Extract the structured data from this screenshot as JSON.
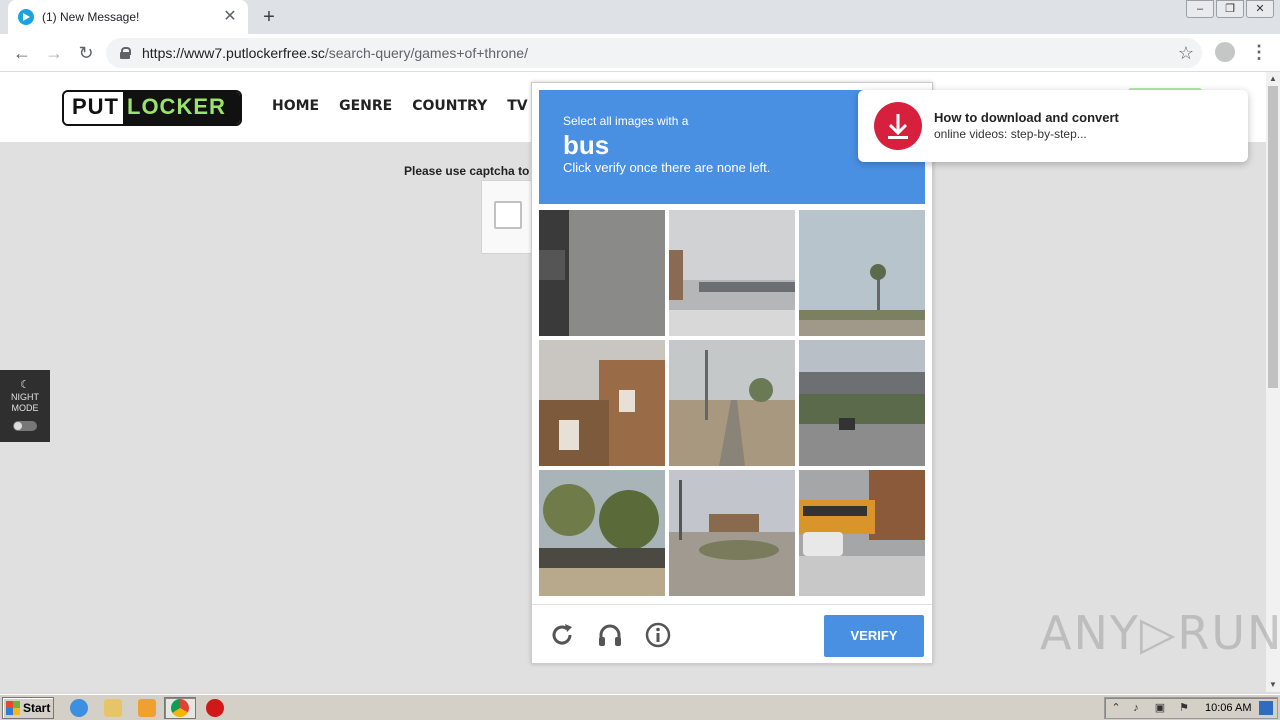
{
  "browser": {
    "tab_title": "(1) New Message!",
    "tab_close": "✕",
    "new_tab": "+",
    "url_host": "https://www7.putlockerfree.sc",
    "url_path": "/search-query/games+of+throne/",
    "back": "←",
    "forward": "→",
    "reload": "↻",
    "star": "☆",
    "menu": "⋮",
    "window_controls": {
      "minimize": "–",
      "restore": "❐",
      "close": "✕"
    }
  },
  "site": {
    "logo_put": "PUT",
    "logo_locker": "LOCKER",
    "nav": [
      "HOME",
      "GENRE",
      "COUNTRY",
      "TV - SER"
    ],
    "captcha_hint": "Please use captcha to",
    "night_mode_line1": "NIGHT",
    "night_mode_line2": "MODE"
  },
  "captcha": {
    "prompt_small": "Select all images with a",
    "object": "bus",
    "instruction": "Click verify once there are none left.",
    "verify_label": "VERIFY",
    "tiles": [
      "car-closeup",
      "parking-lot",
      "palm-road",
      "brick-house",
      "street-road",
      "overpass",
      "trees-cars",
      "intersection",
      "school-bus"
    ]
  },
  "notification": {
    "title": "How to download and convert",
    "text": "online videos: step-by-step..."
  },
  "watermark": "ANY▷RUN",
  "taskbar": {
    "start_label": "Start",
    "clock": "10:06 AM"
  },
  "colors": {
    "captcha_blue": "#4a90e2",
    "notif_red": "#d6203e",
    "logo_green": "#9be36b"
  }
}
